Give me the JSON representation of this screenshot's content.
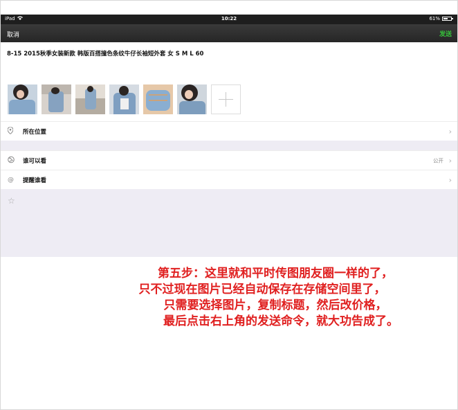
{
  "status_bar": {
    "device": "iPad",
    "time": "10:22",
    "battery": "61%",
    "battery_level": 0.61
  },
  "nav": {
    "cancel_label": "取消",
    "send_label": "发送",
    "send_color": "#36c23a"
  },
  "post": {
    "text": "8-15 2015秋季女装新款 韩版百搭撞色条纹牛仔长袖短外套 女 S M L 60"
  },
  "photos": {
    "count": 6,
    "add_icon": "plus-icon"
  },
  "rows": {
    "location": {
      "icon": "location-pin-icon",
      "label": "所在位置"
    },
    "visibility": {
      "icon": "globe-icon",
      "label": "谁可以看",
      "value": "公开"
    },
    "remind": {
      "icon": "at-icon",
      "label": "提醒谁看"
    },
    "favorite": {
      "icon": "star-icon"
    }
  },
  "annotation": {
    "color": "#e02020",
    "lines": [
      "第五步：这里就和平时传图朋友圈一样的了，",
      "只不过现在图片已经自动保存在存储空间里了，",
      "只需要选择图片，复制标题，然后改价格，",
      "最后点击右上角的发送命令，就大功告成了。"
    ]
  }
}
